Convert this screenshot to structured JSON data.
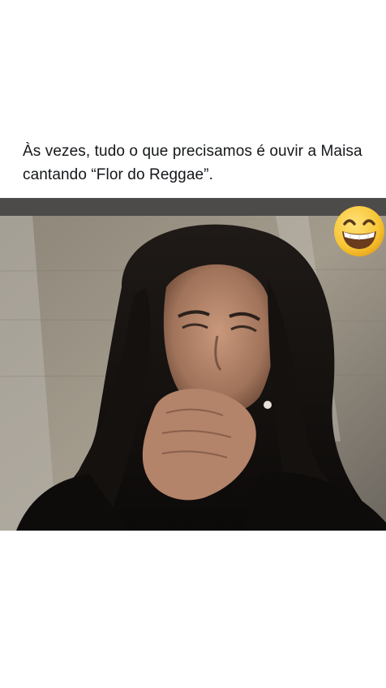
{
  "post": {
    "text": "Às vezes, tudo o que precisamos é ouvir a Maisa cantando “Flor do Reggae”."
  },
  "media": {
    "description_icon": "photo-of-woman-laughing",
    "emoji_icon": "grinning-face-with-smiling-eyes-icon"
  },
  "colors": {
    "background": "#ffffff",
    "text": "#14171a",
    "emoji_yellow": "#f7c534"
  }
}
